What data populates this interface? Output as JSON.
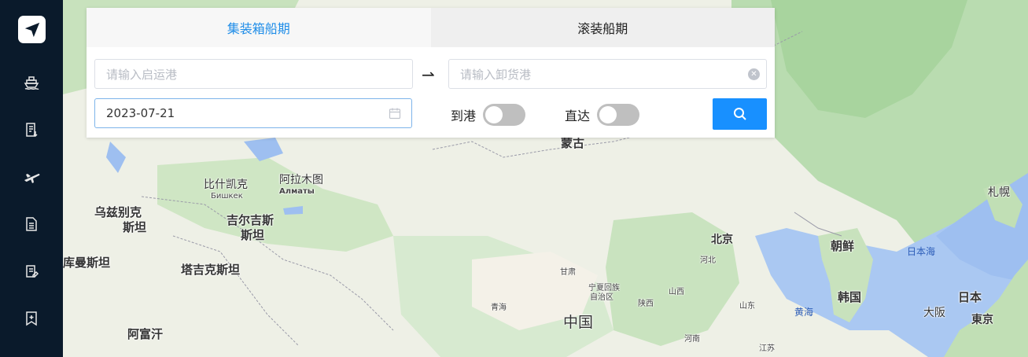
{
  "sidebar": {
    "items": [
      {
        "icon": "ship-icon"
      },
      {
        "icon": "document-download-icon"
      },
      {
        "icon": "airplane-icon"
      },
      {
        "icon": "document-icon"
      },
      {
        "icon": "list-edit-icon"
      },
      {
        "icon": "bookmark-icon"
      }
    ]
  },
  "tabs": {
    "container": "集装箱船期",
    "roro": "滚装船期"
  },
  "form": {
    "origin_placeholder": "请输入启运港",
    "arrow": "⇀",
    "destination_placeholder": "请输入卸货港",
    "date_value": "2023-07-21",
    "to_port_label": "到港",
    "to_port_on": false,
    "direct_label": "直达",
    "direct_on": false
  },
  "map": {
    "labels": {
      "mongolia": "蒙古",
      "bishkek_cn": "比什凯克",
      "bishkek_ru": "Бишкек",
      "almaty_cn": "阿拉木图",
      "almaty_ru": "Алматы",
      "uzbek_1": "乌兹别克",
      "uzbek_2": "斯坦",
      "kyrgyz_1": "吉尔吉斯",
      "kyrgyz_2": "斯坦",
      "turkmen": "库曼斯坦",
      "tajik": "塔吉克斯坦",
      "afghan": "阿富汗",
      "beijing": "北京",
      "hebei": "河北",
      "gansu": "甘肃",
      "ningxia_1": "宁夏回族",
      "ningxia_2": "自治区",
      "shaanxi": "陕西",
      "shanxi": "山西",
      "qinghai": "青海",
      "shandong": "山东",
      "henan": "河南",
      "jiangsu": "江苏",
      "china": "中国",
      "yellow_sea": "黄海",
      "north_korea": "朝鲜",
      "south_korea": "韩国",
      "sea_of_japan": "日本海",
      "japan": "日本",
      "sapporo": "札幌",
      "osaka": "大阪",
      "tokyo": "東京"
    }
  }
}
